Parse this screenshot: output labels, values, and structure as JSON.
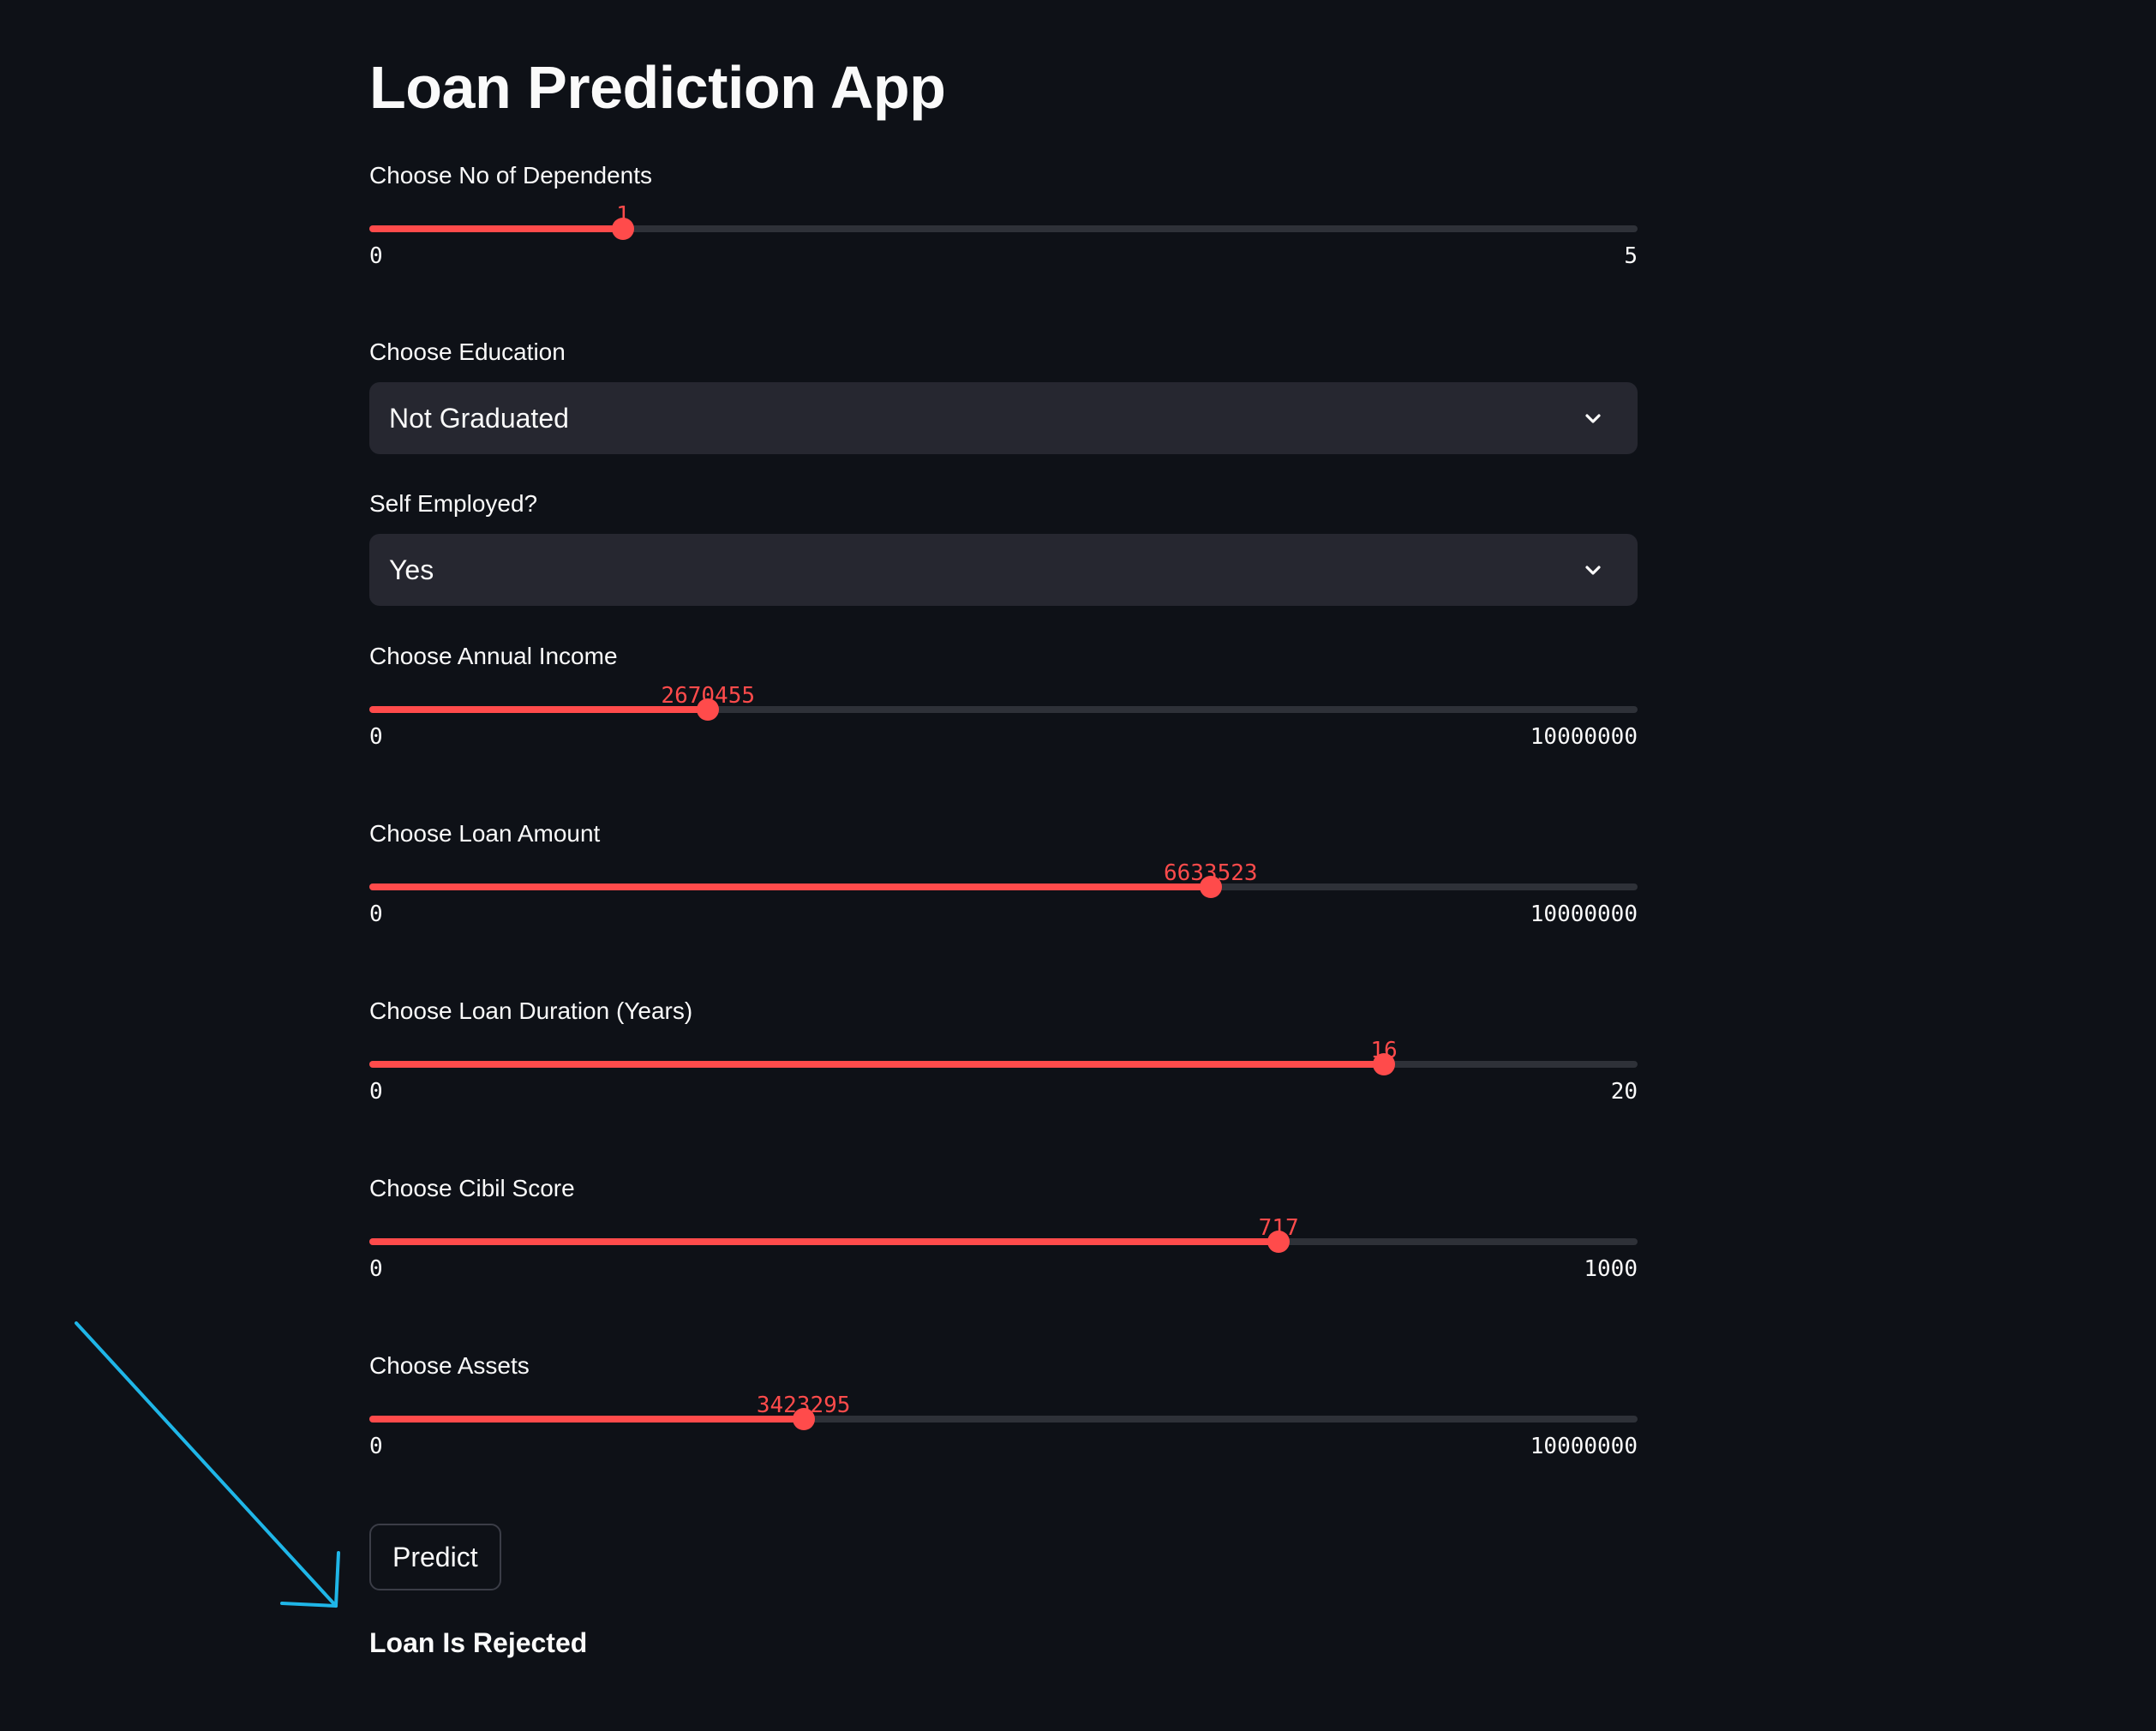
{
  "app": {
    "title": "Loan Prediction App"
  },
  "colors": {
    "background": "#0e1117",
    "accent": "#ff4b4b",
    "track": "#2e3138",
    "select_bg": "#262730",
    "text": "#fafafa",
    "annotation_arrow": "#1fb6e8"
  },
  "dependents": {
    "label": "Choose No of Dependents",
    "value": "1",
    "min": "0",
    "max": "5"
  },
  "education": {
    "label": "Choose Education",
    "selected": "Not Graduated"
  },
  "self_employed": {
    "label": "Self Employed?",
    "selected": "Yes"
  },
  "annual_income": {
    "label": "Choose Annual Income",
    "value": "2670455",
    "min": "0",
    "max": "10000000"
  },
  "loan_amount": {
    "label": "Choose Loan Amount",
    "value": "6633523",
    "min": "0",
    "max": "10000000"
  },
  "loan_duration": {
    "label": "Choose Loan Duration (Years)",
    "value": "16",
    "min": "0",
    "max": "20"
  },
  "cibil_score": {
    "label": "Choose Cibil Score",
    "value": "717",
    "min": "0",
    "max": "1000"
  },
  "assets": {
    "label": "Choose Assets",
    "value": "3423295",
    "min": "0",
    "max": "10000000"
  },
  "predict_button": {
    "label": "Predict"
  },
  "result": {
    "text": "Loan Is Rejected"
  }
}
